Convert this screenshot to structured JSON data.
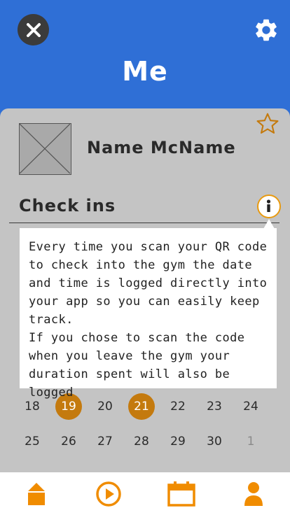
{
  "header": {
    "title": "Me",
    "close_icon": "close-icon",
    "settings_icon": "gear-icon"
  },
  "profile": {
    "name": "Name McName",
    "avatar_icon": "image-placeholder-icon",
    "favorite_icon": "star-outline-icon"
  },
  "checkins": {
    "title": "Check ins",
    "info_icon": "info-icon",
    "tooltip_text": "Every time you scan your QR code\nto check into the gym the date\nand time is logged directly into\nyour app so you can easily keep\ntrack.\nIf you chose to scan the code\nwhen you leave the gym your\nduration spent will also be logged"
  },
  "calendar": {
    "rows": [
      [
        {
          "day": "18",
          "state": "normal"
        },
        {
          "day": "19",
          "state": "checked-in"
        },
        {
          "day": "20",
          "state": "normal"
        },
        {
          "day": "21",
          "state": "today-checked-in"
        },
        {
          "day": "22",
          "state": "normal"
        },
        {
          "day": "23",
          "state": "normal"
        },
        {
          "day": "24",
          "state": "normal"
        }
      ],
      [
        {
          "day": "25",
          "state": "normal"
        },
        {
          "day": "26",
          "state": "normal"
        },
        {
          "day": "27",
          "state": "normal"
        },
        {
          "day": "28",
          "state": "normal"
        },
        {
          "day": "29",
          "state": "normal"
        },
        {
          "day": "30",
          "state": "normal"
        },
        {
          "day": "1",
          "state": "other-month"
        }
      ]
    ]
  },
  "bottom_nav": {
    "items": [
      {
        "icon": "home-icon"
      },
      {
        "icon": "play-icon"
      },
      {
        "icon": "calendar-icon"
      },
      {
        "icon": "profile-icon"
      }
    ]
  },
  "colors": {
    "header_blue": "#2f6fd6",
    "accent_orange": "#f08c00",
    "checkin_circle": "#c47a0e",
    "card_gray": "#c4c4c4"
  }
}
